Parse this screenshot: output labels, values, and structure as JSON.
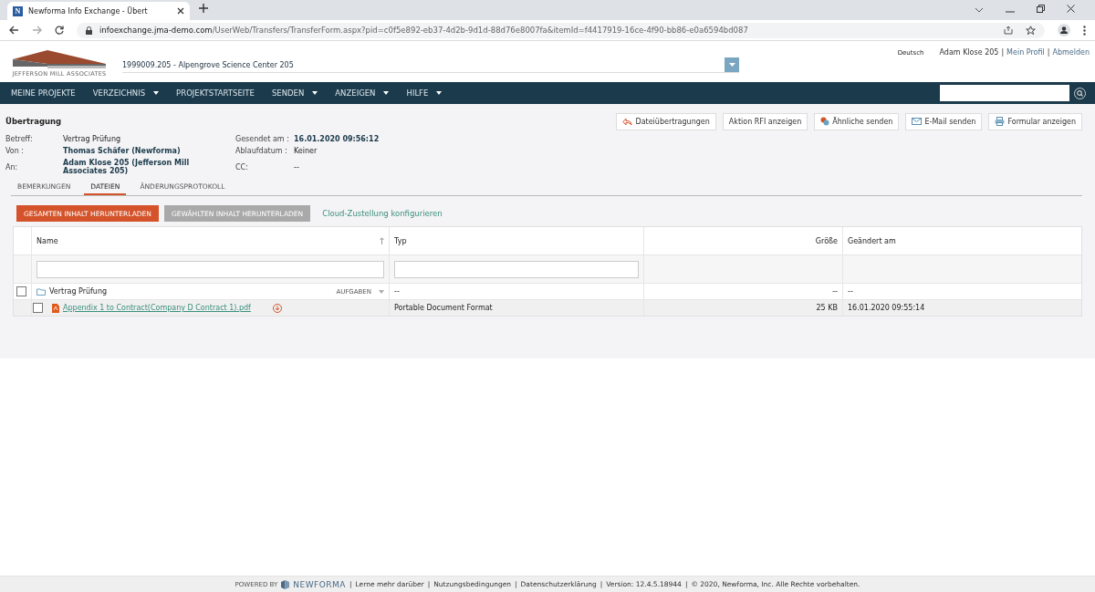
{
  "browser": {
    "tab_title": "Newforma Info Exchange - Übert",
    "favicon": "N",
    "url_host": "infoexchange.jma-demo.com",
    "url_path": "/UserWeb/Transfers/TransferForm.aspx?pid=c0f5e892-eb37-4d2b-9d1d-88d76e8007fa&itemId=f4417919-16ce-4f90-bb86-e0a6594bd087"
  },
  "header": {
    "logo_text": "JEFFERSON MILL ASSOCIATES",
    "project": "1999009.205 - Alpengrove Science Center 205",
    "language": "Deutsch",
    "user": "Adam Klose 205",
    "links": [
      "Mein Profil",
      "Abmelden"
    ],
    "separator": "|"
  },
  "nav": {
    "items": [
      {
        "label": "MEINE PROJEKTE",
        "dropdown": false
      },
      {
        "label": "VERZEICHNIS",
        "dropdown": true
      },
      {
        "label": "PROJEKTSTARTSEITE",
        "dropdown": false
      },
      {
        "label": "SENDEN",
        "dropdown": true
      },
      {
        "label": "ANZEIGEN",
        "dropdown": true
      },
      {
        "label": "HILFE",
        "dropdown": true
      }
    ]
  },
  "page": {
    "title": "Übertragung",
    "actions": [
      {
        "label": "Dateiübertragungen",
        "kind": "reply"
      },
      {
        "label": "Aktion RFI anzeigen",
        "kind": "plain"
      },
      {
        "label": "Ähnliche senden",
        "kind": "copy"
      },
      {
        "label": "E-Mail senden",
        "kind": "mail"
      },
      {
        "label": "Formular anzeigen",
        "kind": "print"
      }
    ],
    "fields_left": [
      {
        "label": "Betreff:",
        "value": "Vertrag Prüfung",
        "bold": false
      },
      {
        "label": "Von :",
        "value": "Thomas Schäfer (Newforma)",
        "bold": true
      },
      {
        "label": "An:",
        "value": "Adam Klose 205 (Jefferson Mill Associates 205)",
        "bold": true
      }
    ],
    "fields_right": [
      {
        "label": "Gesendet am :",
        "value": "16.01.2020 09:56:12",
        "bold": true
      },
      {
        "label": "Ablaufdatum :",
        "value": "Keiner",
        "bold": false
      },
      {
        "label": "CC:",
        "value": "--",
        "bold": false
      }
    ],
    "tabs": [
      {
        "label": "BEMERKUNGEN",
        "selected": false
      },
      {
        "label": "DATEIEN",
        "selected": true
      },
      {
        "label": "ÄNDERUNGSPROTOKOLL",
        "selected": false
      }
    ],
    "buttons": [
      {
        "label": "GESAMTEN INHALT HERUNTERLADEN",
        "disabled": false
      },
      {
        "label": "GEWÄHLTEN INHALT HERUNTERLADEN",
        "disabled": true
      }
    ],
    "cloud_link": "Cloud-Zustellung konfigurieren",
    "table": {
      "columns": [
        "Name",
        "Typ",
        "Größe",
        "Geändert am"
      ],
      "rows": [
        {
          "kind": "folder",
          "checked": false,
          "name": "Vertrag Prüfung",
          "menu": "AUFGABEN",
          "type": "--",
          "size": "--",
          "modified": "--",
          "children": [
            {
              "kind": "file",
              "checked": false,
              "name": "Appendix 1 to Contract(Company D Contract 1).pdf",
              "type": "Portable Document Format",
              "size": "25 KB",
              "modified": "16.01.2020 09:55:14"
            }
          ]
        }
      ]
    }
  },
  "footer": {
    "powered_by": "POWERED BY",
    "brand": "NEWFORMA",
    "separator": "|",
    "items": [
      "Lerne mehr darüber",
      "Nutzungsbedingungen",
      "Datenschutzerklärung",
      "Version: 12.4.5.18944",
      "© 2020, Newforma, Inc. Alle Rechte vorbehalten."
    ]
  }
}
